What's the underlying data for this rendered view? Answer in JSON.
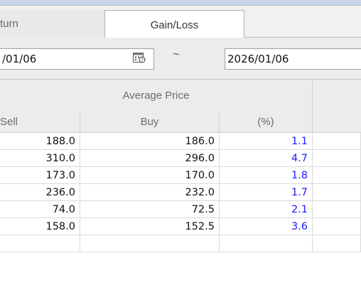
{
  "tabs": [
    {
      "label": "turn"
    },
    {
      "label": "Gain/Loss"
    }
  ],
  "date_range": {
    "start": "/01/06",
    "separator": "~",
    "end": "2026/01/06"
  },
  "table": {
    "group_header": "Average Price",
    "columns": [
      "Sell",
      "Buy",
      "(%)"
    ],
    "rows": [
      {
        "sell": "188.0",
        "buy": "186.0",
        "pct": "1.1"
      },
      {
        "sell": "310.0",
        "buy": "296.0",
        "pct": "4.7"
      },
      {
        "sell": "173.0",
        "buy": "170.0",
        "pct": "1.8"
      },
      {
        "sell": "236.0",
        "buy": "232.0",
        "pct": "1.7"
      },
      {
        "sell": "74.0",
        "buy": "72.5",
        "pct": "2.1"
      },
      {
        "sell": "158.0",
        "buy": "152.5",
        "pct": "3.6"
      }
    ]
  },
  "colors": {
    "percent_text": "#1a1aff",
    "header_bg": "#ececec"
  },
  "icons": {
    "calendar": "calendar-icon"
  }
}
